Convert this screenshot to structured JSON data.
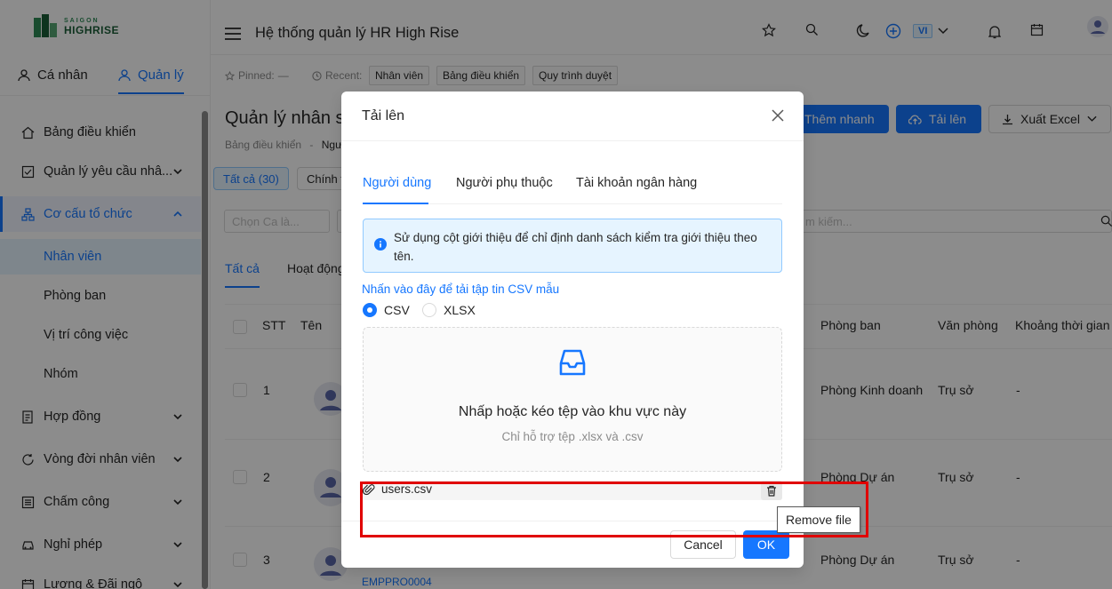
{
  "app": {
    "logo_top": "SAIGON",
    "logo_bottom": "HIGHRISE",
    "title": "Hệ thống quản lý HR High Rise",
    "lang": "VI"
  },
  "sidebar": {
    "tabs": [
      {
        "label": "Cá nhân"
      },
      {
        "label": "Quản lý"
      }
    ],
    "items": [
      {
        "label": "Bảng điều khiển"
      },
      {
        "label": "Quản lý yêu cầu nhâ..."
      },
      {
        "label": "Cơ cấu tổ chức"
      },
      {
        "label": "Nhân viên"
      },
      {
        "label": "Phòng ban"
      },
      {
        "label": "Vị trí công việc"
      },
      {
        "label": "Nhóm"
      },
      {
        "label": "Hợp đồng"
      },
      {
        "label": "Vòng đời nhân viên"
      },
      {
        "label": "Chấm công"
      },
      {
        "label": "Nghỉ phép"
      },
      {
        "label": "Lương & Đãi ngộ"
      }
    ]
  },
  "pinbar": {
    "pinned_label": "Pinned:",
    "pinned_value": "—",
    "recent_label": "Recent:",
    "recent": [
      "Nhân viên",
      "Bảng điều khiển",
      "Quy trình duyệt"
    ]
  },
  "page": {
    "title": "Quản lý nhân s",
    "breadcrumb_root": "Bảng điều khiển",
    "breadcrumb_sep": "-",
    "breadcrumb_current": "Ngư",
    "quick_add": "Thêm nhanh",
    "upload": "Tải lên",
    "export": "Xuất Excel",
    "filter_all": "Tất cả (30)",
    "filter_official": "Chính t",
    "select_shift": "Chọn Ca là...",
    "search_placeholder": "m kiếm...",
    "list_tabs": [
      "Tất cả",
      "Hoạt động"
    ]
  },
  "table": {
    "headers": {
      "stt": "STT",
      "name": "Tên",
      "dept": "Phòng ban",
      "office": "Văn phòng",
      "period": "Khoảng thời gian"
    },
    "rows": [
      {
        "stt": "1",
        "dept": "Phòng Kinh doanh",
        "office": "Trụ sở",
        "period": "-"
      },
      {
        "stt": "2",
        "dept": "Phòng Dự án",
        "office": "Trụ sở",
        "period": "-"
      },
      {
        "stt": "3",
        "dept": "Phòng Dự án",
        "office": "Trụ sở",
        "period": "-",
        "code": "EMPPRO0004"
      }
    ]
  },
  "modal": {
    "title": "Tải lên",
    "tabs": [
      "Người dùng",
      "Người phụ thuộc",
      "Tài khoản ngân hàng"
    ],
    "alert": "Sử dụng cột giới thiệu để chỉ định danh sách kiểm tra giới thiệu theo tên.",
    "sample_link": "Nhấn vào đây để tải tập tin CSV mẫu",
    "formats": [
      "CSV",
      "XLSX"
    ],
    "selected_format": "CSV",
    "drop_text": "Nhấp hoặc kéo tệp vào khu vực này",
    "drop_hint": "Chỉ hỗ trợ tệp .xlsx và .csv",
    "file_name": "users.csv",
    "cancel": "Cancel",
    "ok": "OK"
  },
  "tooltip": "Remove file",
  "colors": {
    "primary": "#1677ff",
    "highlight": "#e00000"
  }
}
